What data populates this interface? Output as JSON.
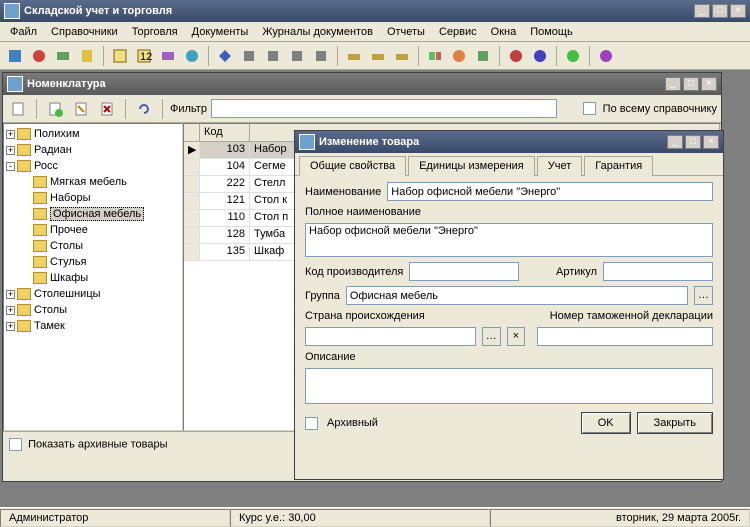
{
  "app": {
    "title": "Складской учет и торговля"
  },
  "menu": [
    "Файл",
    "Справочники",
    "Торговля",
    "Документы",
    "Журналы документов",
    "Отчеты",
    "Сервис",
    "Окна",
    "Помощь"
  ],
  "nom": {
    "title": "Номенклатура",
    "filter_label": "Фильтр",
    "whole_dir_label": "По всему справочнику",
    "show_archive_label": "Показать архивные товары",
    "tree": {
      "items": [
        {
          "exp": "+",
          "label": "Полихим",
          "indent": 0
        },
        {
          "exp": "+",
          "label": "Радиан",
          "indent": 0
        },
        {
          "exp": "-",
          "label": "Росс",
          "indent": 0
        },
        {
          "exp": "",
          "label": "Мягкая мебель",
          "indent": 1
        },
        {
          "exp": "",
          "label": "Наборы",
          "indent": 1
        },
        {
          "exp": "",
          "label": "Офисная мебель",
          "indent": 1,
          "sel": true
        },
        {
          "exp": "",
          "label": "Прочее",
          "indent": 1
        },
        {
          "exp": "",
          "label": "Столы",
          "indent": 1
        },
        {
          "exp": "",
          "label": "Стулья",
          "indent": 1
        },
        {
          "exp": "",
          "label": "Шкафы",
          "indent": 1
        },
        {
          "exp": "+",
          "label": "Столешницы",
          "indent": 0
        },
        {
          "exp": "+",
          "label": "Столы",
          "indent": 0
        },
        {
          "exp": "+",
          "label": "Тамек",
          "indent": 0
        }
      ]
    },
    "grid": {
      "col_code": "Код",
      "rows": [
        {
          "code": "103",
          "name": "Набор",
          "ptr": "▶"
        },
        {
          "code": "104",
          "name": "Сегме"
        },
        {
          "code": "222",
          "name": "Стелл"
        },
        {
          "code": "121",
          "name": "Стол к"
        },
        {
          "code": "110",
          "name": "Стол п"
        },
        {
          "code": "128",
          "name": "Тумба"
        },
        {
          "code": "135",
          "name": "Шкаф"
        }
      ]
    }
  },
  "edit": {
    "title": "Изменение товара",
    "tabs": [
      "Общие свойства",
      "Единицы измерения",
      "Учет",
      "Гарантия"
    ],
    "labels": {
      "name": "Наименование",
      "fullname": "Полное наименование",
      "mfrcode": "Код производителя",
      "article": "Артикул",
      "group": "Группа",
      "country": "Страна происхождения",
      "decl": "Номер таможенной декларации",
      "desc": "Описание",
      "archive": "Архивный",
      "ok": "OK",
      "close": "Закрыть"
    },
    "values": {
      "name": "Набор офисной мебели \"Энерго\"",
      "fullname": "Набор офисной мебели \"Энерго\"",
      "mfrcode": "",
      "article": "",
      "group": "Офисная мебель",
      "country": "",
      "decl": "",
      "desc": ""
    }
  },
  "status": {
    "user": "Администратор",
    "rate": "Курс у.е.: 30,00",
    "date": "вторник, 29 марта 2005г."
  }
}
